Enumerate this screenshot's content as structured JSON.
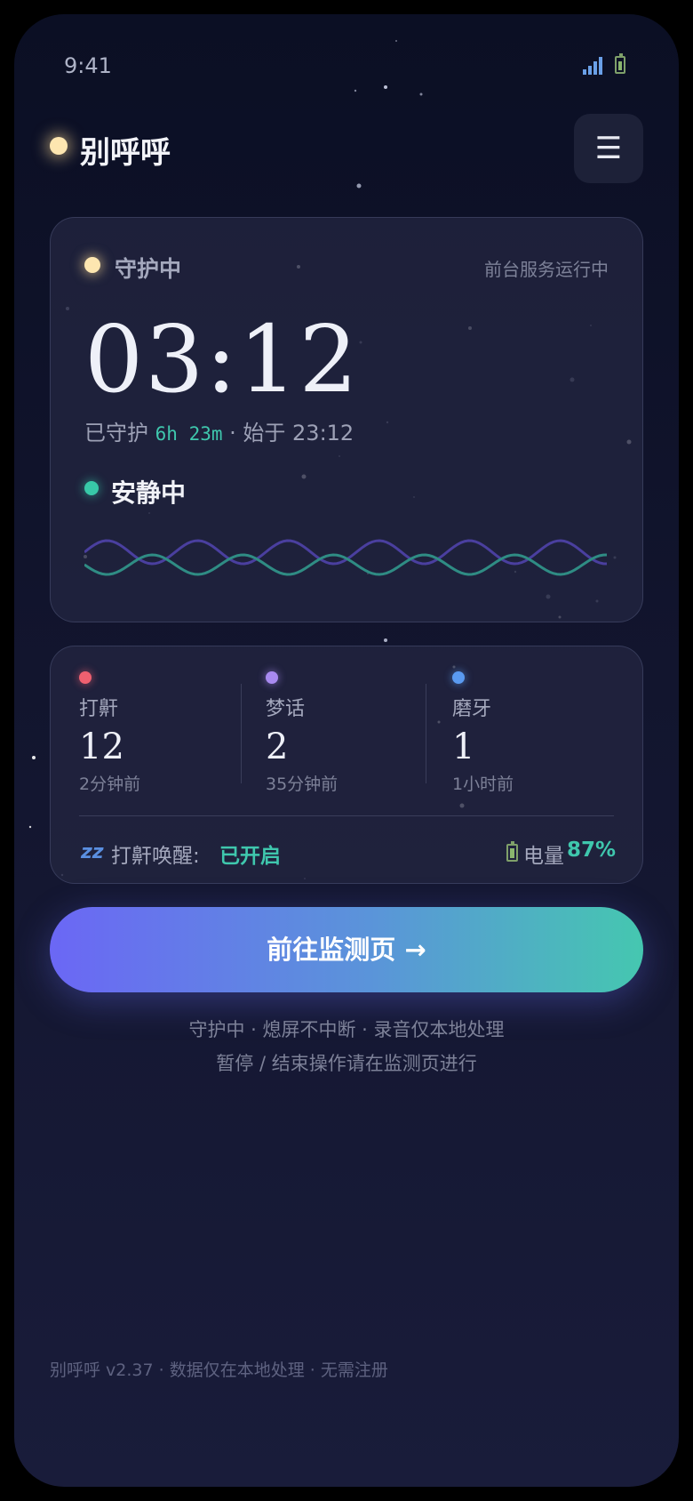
{
  "status_bar": {
    "time": "9:41"
  },
  "header": {
    "title": "别呼呼",
    "menu_icon": "☰"
  },
  "guard_card": {
    "status_label": "守护中",
    "service_label": "前台服务运行中",
    "clock": "03:12",
    "guarded_prefix": "已守护",
    "guarded_duration": "6h 23m",
    "started_text": "· 始于 23:12",
    "state_label": "安静中",
    "colors": {
      "state_dot": "#38c9a8",
      "wave_a": "#4a3f9f",
      "wave_b": "#2f8c84"
    }
  },
  "stats": {
    "items": [
      {
        "name": "打鼾",
        "count": "12",
        "ago": "2分钟前",
        "color": "#f06070"
      },
      {
        "name": "梦话",
        "count": "2",
        "ago": "35分钟前",
        "color": "#a88af0"
      },
      {
        "name": "磨牙",
        "count": "1",
        "ago": "1小时前",
        "color": "#5a9af0"
      }
    ],
    "snore_wake_label": "打鼾唤醒:",
    "snore_wake_value": "已开启",
    "battery_label": "电量",
    "battery_value": "87%"
  },
  "cta": {
    "label": "前往监测页 →"
  },
  "hints": [
    "守护中 · 熄屏不中断 · 录音仅本地处理",
    "暂停 / 结束操作请在监测页进行"
  ],
  "footer": {
    "text": "别呼呼 v2.37 · 数据仅在本地处理 · 无需注册"
  }
}
